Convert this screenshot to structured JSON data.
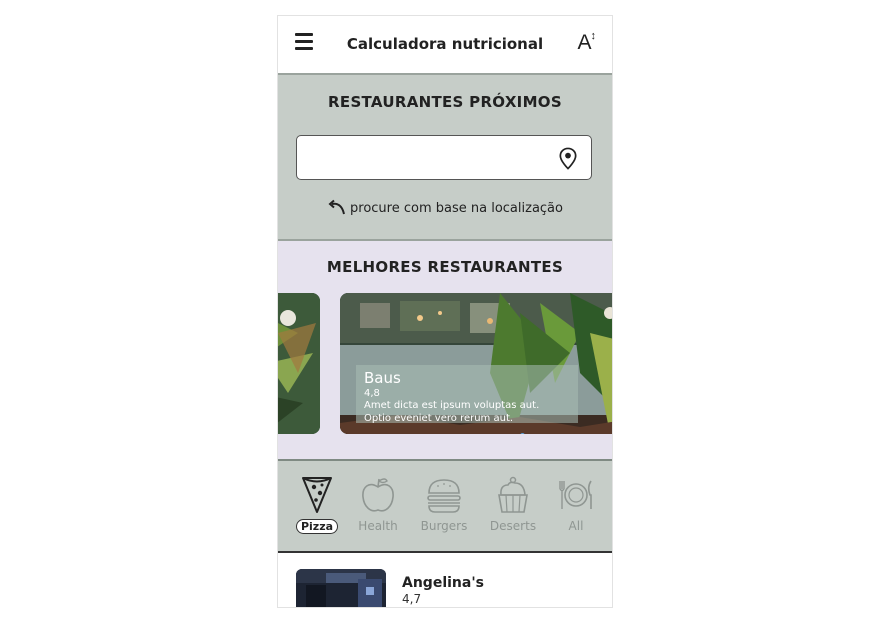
{
  "app": {
    "title": "Calculadora nutricional",
    "font_size_glyph": "A"
  },
  "nearby": {
    "title": "RESTAURANTES PRÓXIMOS",
    "search_value": "",
    "locate_label": "procure com base na localização"
  },
  "best": {
    "title": "MELHORES RESTAURANTES",
    "featured": {
      "name": "Baus",
      "rating": "4,8",
      "description_line1": "Amet dicta est ipsum voluptas aut.",
      "description_line2": "Optio eveniet vero rerum aut."
    }
  },
  "categories": [
    {
      "label": "Pizza",
      "icon": "pizza-icon",
      "active": true
    },
    {
      "label": "Health",
      "icon": "apple-icon",
      "active": false
    },
    {
      "label": "Burgers",
      "icon": "burger-icon",
      "active": false
    },
    {
      "label": "Deserts",
      "icon": "cupcake-icon",
      "active": false
    },
    {
      "label": "All",
      "icon": "cutlery-icon",
      "active": false
    }
  ],
  "restaurants": [
    {
      "name": "Angelina's",
      "rating": "4,7"
    }
  ],
  "colors": {
    "nearby_bg": "#c6cdc8",
    "best_bg": "#e6e2ee",
    "inactive_category": "#8f9692",
    "carousel_dot": "#5aa0d8"
  }
}
